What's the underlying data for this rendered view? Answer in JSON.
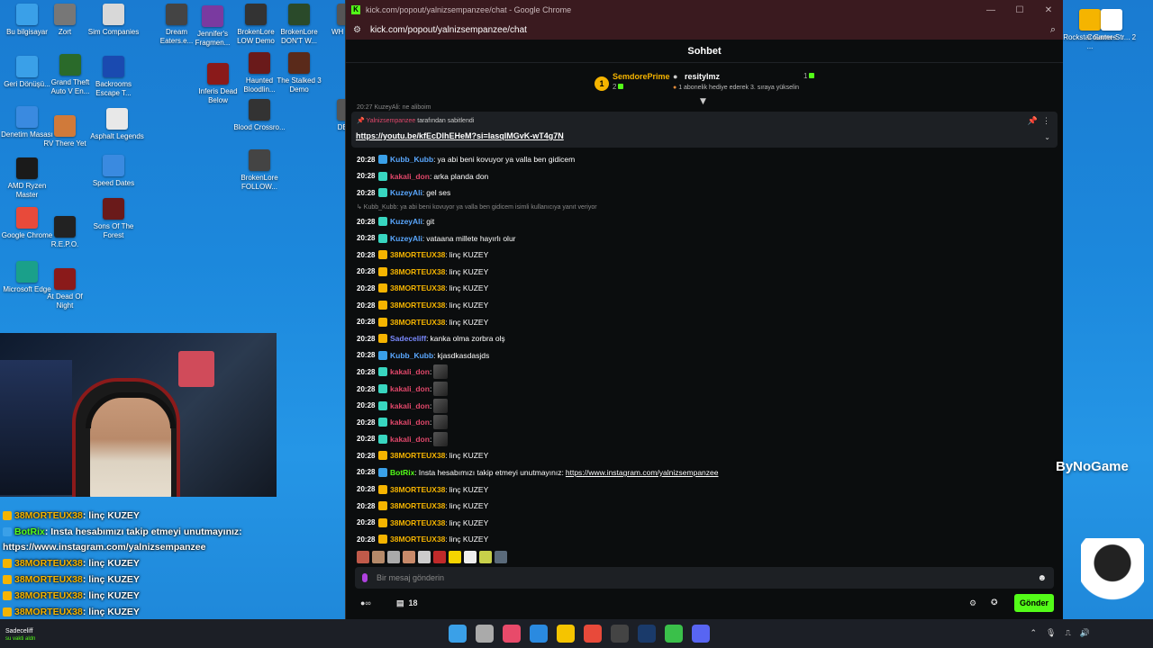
{
  "desktop_icons": [
    {
      "label": "Bu bilgisayar",
      "color": "#3aa0e8"
    },
    {
      "label": "Zort",
      "color": "#777"
    },
    {
      "label": "Sim Companies",
      "color": "#d8d8d8"
    },
    {
      "label": "Dream Eaters.e...",
      "color": "#444"
    },
    {
      "label": "Jennifer's Fragmen...",
      "color": "#7a3aa0"
    },
    {
      "label": "BrokenLore LOW Demo",
      "color": "#333"
    },
    {
      "label": "BrokenLore DON'T W...",
      "color": "#2a4a2a"
    },
    {
      "label": "Geri Dönüşü...",
      "color": "#3aa0e8"
    },
    {
      "label": "Grand Theft Auto V En...",
      "color": "#2a6a2a"
    },
    {
      "label": "Backrooms Escape T...",
      "color": "#1a4ab0"
    },
    {
      "label": "Inferis Dead Below",
      "color": "#8a1a1a"
    },
    {
      "label": "Haunted Bloodlin...",
      "color": "#6a1a1a"
    },
    {
      "label": "The Stalked 3 Demo",
      "color": "#5a2a1a"
    },
    {
      "label": "Denetim Masası",
      "color": "#3a8ae0"
    },
    {
      "label": "RV There Yet",
      "color": "#d07a3a"
    },
    {
      "label": "Asphalt Legends",
      "color": "#e8e8e8"
    },
    {
      "label": "Blood Crossro...",
      "color": "#333"
    },
    {
      "label": "AMD Ryzen Master",
      "color": "#1a1a1a"
    },
    {
      "label": "Speed Dates",
      "color": "#3a8ae0"
    },
    {
      "label": "BrokenLore FOLLOW...",
      "color": "#444"
    },
    {
      "label": "Google Chrome",
      "color": "#e84a3a"
    },
    {
      "label": "R.E.P.O.",
      "color": "#222"
    },
    {
      "label": "Sons Of The Forest",
      "color": "#6a1a1a"
    },
    {
      "label": "Microsoft Edge",
      "color": "#1aa08a"
    },
    {
      "label": "At Dead Of Night",
      "color": "#8a1a1a"
    },
    {
      "label": "WH Sleep",
      "color": "#555"
    },
    {
      "label": "DEVO",
      "color": "#555"
    },
    {
      "label": "Rockstar Games ...",
      "color": "#f5b400"
    },
    {
      "label": "Counter-Str... 2",
      "color": "#fff"
    }
  ],
  "window": {
    "title": "kick.com/popout/yalnizsempanzee/chat - Google Chrome",
    "url": "kick.com/popout/yalnizsempanzee/chat",
    "min": "—",
    "max": "☐",
    "close": "✕"
  },
  "chat": {
    "header": "Sohbet",
    "leaderboard": {
      "first": {
        "rank": "1",
        "name": "SemdorePrime",
        "count": "2"
      },
      "second": {
        "name": "resitylmz",
        "count": "1"
      },
      "note": "1 abonelik hediye ederek 3. sıraya yükselin"
    },
    "top_cut": "20:27  KuzeyAli: ne aliboim",
    "pinned": {
      "user": "Yalnizsempanzee",
      "suffix": "tarafından sabitlendi",
      "link": "https://youtu.be/kfEcDlhEHeM?si=IasqlMGvK-wT4g7N"
    },
    "messages": [
      {
        "time": "20:28",
        "user": "Kubb_Kubb",
        "user_color": "#5aa8ff",
        "badge_color": "#3aa0e8",
        "text": "ya abi beni kovuyor ya valla ben gidicem"
      },
      {
        "time": "20:28",
        "user": "kakali_don",
        "user_color": "#e0476a",
        "badge_color": "#38d6c0",
        "text": "arka planda don"
      },
      {
        "time": "20:28",
        "user": "KuzeyAli",
        "user_color": "#5aa8ff",
        "badge_color": "#38d6c0",
        "text": "gel ses"
      },
      {
        "reply": "↳ Kubb_Kubb: ya abi beni kovuyor ya valla ben gidicem isimli kullanıcıya yanıt veriyor"
      },
      {
        "time": "20:28",
        "user": "KuzeyAli",
        "user_color": "#5aa8ff",
        "badge_color": "#38d6c0",
        "text": "git"
      },
      {
        "time": "20:28",
        "user": "KuzeyAli",
        "user_color": "#5aa8ff",
        "badge_color": "#38d6c0",
        "text": "vataana millete hayırlı olur"
      },
      {
        "time": "20:28",
        "user": "38MORTEUX38",
        "user_color": "#f5b400",
        "badge_color": "#f5b400",
        "text": "linç KUZEY"
      },
      {
        "time": "20:28",
        "user": "38MORTEUX38",
        "user_color": "#f5b400",
        "badge_color": "#f5b400",
        "text": "linç KUZEY"
      },
      {
        "time": "20:28",
        "user": "38MORTEUX38",
        "user_color": "#f5b400",
        "badge_color": "#f5b400",
        "text": "linç KUZEY"
      },
      {
        "time": "20:28",
        "user": "38MORTEUX38",
        "user_color": "#f5b400",
        "badge_color": "#f5b400",
        "text": "linç KUZEY"
      },
      {
        "time": "20:28",
        "user": "38MORTEUX38",
        "user_color": "#f5b400",
        "badge_color": "#f5b400",
        "text": "linç KUZEY"
      },
      {
        "time": "20:28",
        "user": "Sadeceliff",
        "user_color": "#7a8aff",
        "badge_color": "#f5b400",
        "text": "kanka olma zorbra olş"
      },
      {
        "time": "20:28",
        "user": "Kubb_Kubb",
        "user_color": "#5aa8ff",
        "badge_color": "#3aa0e8",
        "text": "kjasdkasdasjds"
      },
      {
        "time": "20:28",
        "user": "kakali_don",
        "user_color": "#e0476a",
        "badge_color": "#38d6c0",
        "emote": true
      },
      {
        "time": "20:28",
        "user": "kakali_don",
        "user_color": "#e0476a",
        "badge_color": "#38d6c0",
        "emote": true
      },
      {
        "time": "20:28",
        "user": "kakali_don",
        "user_color": "#e0476a",
        "badge_color": "#38d6c0",
        "emote": true
      },
      {
        "time": "20:28",
        "user": "kakali_don",
        "user_color": "#e0476a",
        "badge_color": "#38d6c0",
        "emote": true
      },
      {
        "time": "20:28",
        "user": "kakali_don",
        "user_color": "#e0476a",
        "badge_color": "#38d6c0",
        "emote": true
      },
      {
        "time": "20:28",
        "user": "38MORTEUX38",
        "user_color": "#f5b400",
        "badge_color": "#f5b400",
        "text": "linç KUZEY"
      },
      {
        "time": "20:28",
        "user": "BotRix",
        "user_color": "#53fc18",
        "badge_color": "#3aa0e8",
        "text": "Insta hesabımızı takip etmeyi unutmayınız:",
        "link": "https://www.instagram.com/yalnizsempanzee"
      },
      {
        "time": "20:28",
        "user": "38MORTEUX38",
        "user_color": "#f5b400",
        "badge_color": "#f5b400",
        "text": "linç KUZEY"
      },
      {
        "time": "20:28",
        "user": "38MORTEUX38",
        "user_color": "#f5b400",
        "badge_color": "#f5b400",
        "text": "linç KUZEY"
      },
      {
        "time": "20:28",
        "user": "38MORTEUX38",
        "user_color": "#f5b400",
        "badge_color": "#f5b400",
        "text": "linç KUZEY"
      },
      {
        "time": "20:28",
        "user": "38MORTEUX38",
        "user_color": "#f5b400",
        "badge_color": "#f5b400",
        "text": "linç KUZEY"
      }
    ],
    "input_placeholder": "Bir mesaj gönderin",
    "footer_count": "18",
    "send_label": "Gönder"
  },
  "overlay_chat": [
    {
      "name": "38MORTEUX38",
      "text": " : linç KUZEY",
      "color": "#f5b400"
    },
    {
      "name": "BotRix",
      "text": " : Insta hesabımızı takip etmeyi unutmayınız:",
      "color": "#53fc18"
    },
    {
      "name": "",
      "text": "https://www.instagram.com/yalnizsempanzee",
      "color": "#fff"
    },
    {
      "name": "38MORTEUX38",
      "text": " : linç KUZEY",
      "color": "#f5b400"
    },
    {
      "name": "38MORTEUX38",
      "text": " : linç KUZEY",
      "color": "#f5b400"
    },
    {
      "name": "38MORTEUX38",
      "text": " : linç KUZEY",
      "color": "#f5b400"
    },
    {
      "name": "38MORTEUX38",
      "text": " : linç KUZEY",
      "color": "#f5b400"
    }
  ],
  "brand": "ByNoGame",
  "taskbar": {
    "user": "Sadeceliff",
    "user_sub": "su vakti aldn"
  },
  "colors": {
    "kick_green": "#53fc18",
    "accent_gold": "#f5b400"
  }
}
